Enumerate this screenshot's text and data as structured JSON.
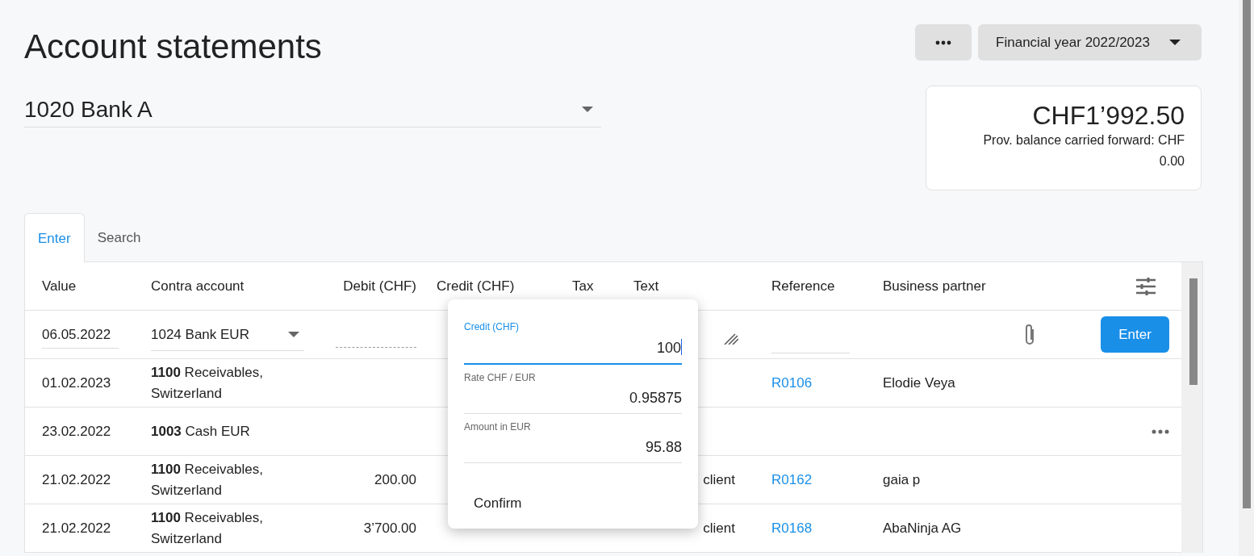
{
  "page": {
    "title": "Account statements",
    "year_selector": "Financial year 2022/2023"
  },
  "account": {
    "value": "1020 Bank A"
  },
  "balance": {
    "amount": "CHF1’992.50",
    "note": "Prov. balance carried forward: CHF",
    "note_value": "0.00"
  },
  "tabs": [
    {
      "label": "Enter",
      "selected": true
    },
    {
      "label": "Search",
      "selected": false
    }
  ],
  "table": {
    "columns": [
      "Value",
      "Contra account",
      "Debit (CHF)",
      "Credit (CHF)",
      "Tax",
      "Text",
      "Reference",
      "Business partner"
    ],
    "entry_row": {
      "value": "06.05.2022",
      "contra_account": "1024 Bank EUR",
      "button": "Enter"
    },
    "rows": [
      {
        "value": "01.02.2023",
        "contra_account": "**1100** Receivables, Switzerland",
        "debit": "",
        "text": "",
        "reference": "R0106",
        "business_partner": "Elodie Veya",
        "more": false
      },
      {
        "value": "23.02.2022",
        "contra_account": "**1003** Cash EUR",
        "debit": "",
        "text": "",
        "reference": "",
        "business_partner": "",
        "more": true
      },
      {
        "value": "21.02.2022",
        "contra_account": "**1100** Receivables, Switzerland",
        "debit": "200.00",
        "text": "client",
        "reference": "R0162",
        "business_partner": "gaia p",
        "more": false
      },
      {
        "value": "21.02.2022",
        "contra_account": "**1100** Receivables, Switzerland",
        "debit": "3’700.00",
        "text": "client",
        "reference": "R0168",
        "business_partner": "AbaNinja AG",
        "more": false
      }
    ]
  },
  "currency_popup": {
    "credit_label": "Credit (CHF)",
    "credit_value": "100",
    "rate_label": "Rate CHF / EUR",
    "rate_value": "0.95875",
    "amount_label": "Amount in EUR",
    "amount_value": "95.88",
    "confirm": "Confirm"
  }
}
